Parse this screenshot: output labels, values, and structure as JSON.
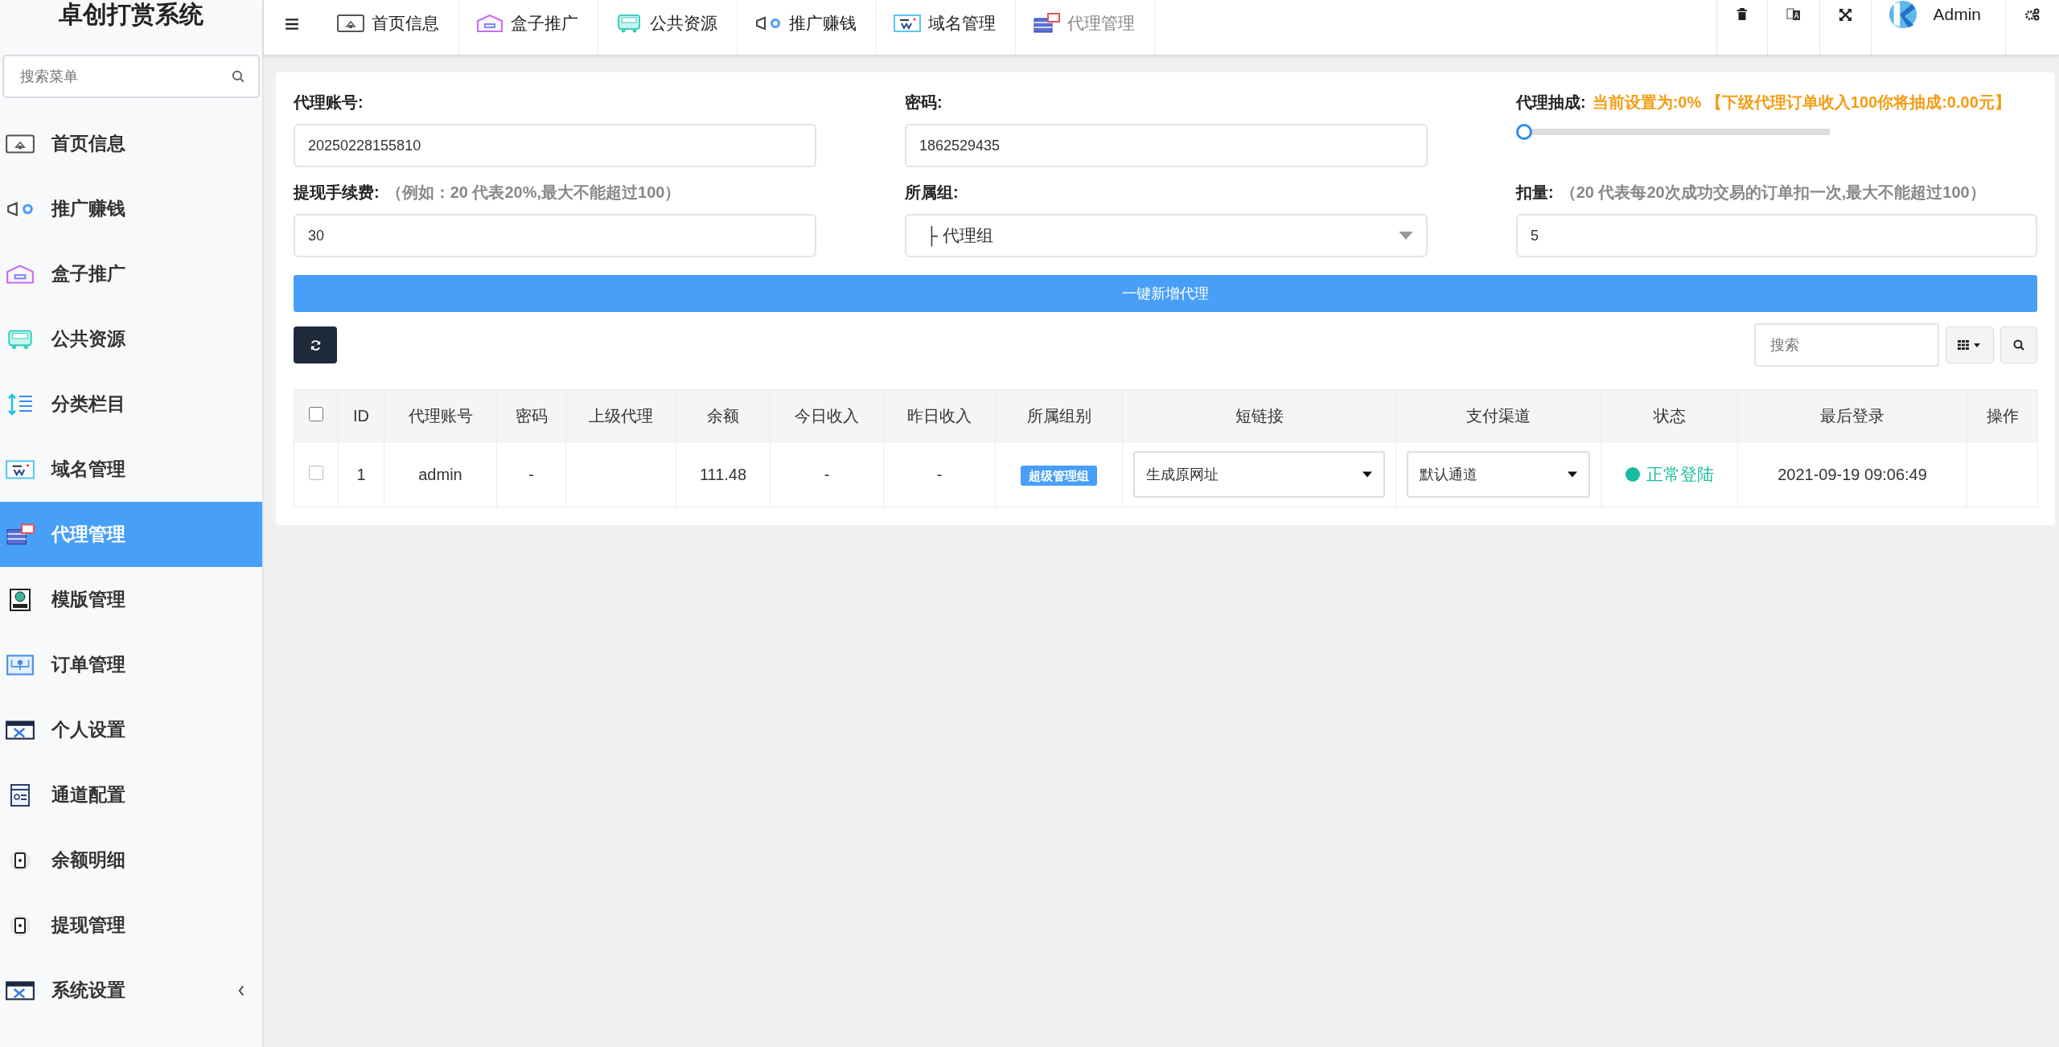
{
  "sidebar": {
    "title": "卓创打赏系统",
    "search": {
      "placeholder": "搜索菜单"
    },
    "items": [
      {
        "label": "首页信息",
        "selected": false
      },
      {
        "label": "推广赚钱",
        "selected": false
      },
      {
        "label": "盒子推广",
        "selected": false
      },
      {
        "label": "公共资源",
        "selected": false
      },
      {
        "label": "分类栏目",
        "selected": false
      },
      {
        "label": "域名管理",
        "selected": false
      },
      {
        "label": "代理管理",
        "selected": true
      },
      {
        "label": "模版管理",
        "selected": false
      },
      {
        "label": "订单管理",
        "selected": false
      },
      {
        "label": "个人设置",
        "selected": false
      },
      {
        "label": "通道配置",
        "selected": false
      },
      {
        "label": "余额明细",
        "selected": false
      },
      {
        "label": "提现管理",
        "selected": false
      },
      {
        "label": "系统设置",
        "selected": false
      }
    ]
  },
  "tabs": [
    {
      "label": "首页信息",
      "selected": false
    },
    {
      "label": "盒子推广",
      "selected": false
    },
    {
      "label": "公共资源",
      "selected": false
    },
    {
      "label": "推广赚钱",
      "selected": false
    },
    {
      "label": "域名管理",
      "selected": false
    },
    {
      "label": "代理管理",
      "selected": true
    }
  ],
  "user": {
    "name": "Admin"
  },
  "form": {
    "account": {
      "label": "代理账号:",
      "value": "20250228155810"
    },
    "password": {
      "label": "密码:",
      "value": "1862529435"
    },
    "commission": {
      "label": "代理抽成:",
      "note": "当前设置为:0% 【下级代理订单收入100你将抽成:0.00元】",
      "level": 0
    },
    "fee": {
      "label": "提现手续费:",
      "hint": "（例如：20 代表20%,最大不能超过100）",
      "value": "30"
    },
    "group": {
      "label": "所属组:",
      "value": "├ 代理组"
    },
    "deduct": {
      "label": "扣量:",
      "hint": "（20 代表每20次成功交易的订单扣一次,最大不能超过100）",
      "value": "5"
    },
    "submit": "一键新增代理"
  },
  "toolbar": {
    "search": {
      "placeholder": "搜索"
    }
  },
  "table": {
    "header_checked": false,
    "columns": [
      "ID",
      "代理账号",
      "密码",
      "上级代理",
      "余额",
      "今日收入",
      "昨日收入",
      "所属组别",
      "短链接",
      "支付渠道",
      "状态",
      "最后登录",
      "操作"
    ],
    "rows": [
      {
        "selected": false,
        "id": "1",
        "account": "admin",
        "password": "-",
        "balance": "111.48",
        "today": "-",
        "yesterday": "-",
        "group": "超级管理组",
        "short_link": "生成原网址",
        "channel": "默认通道",
        "status": {
          "text": "正常登陆",
          "color": "#18bc9c"
        },
        "last_login": "2021-09-19 09:06:49"
      }
    ]
  }
}
